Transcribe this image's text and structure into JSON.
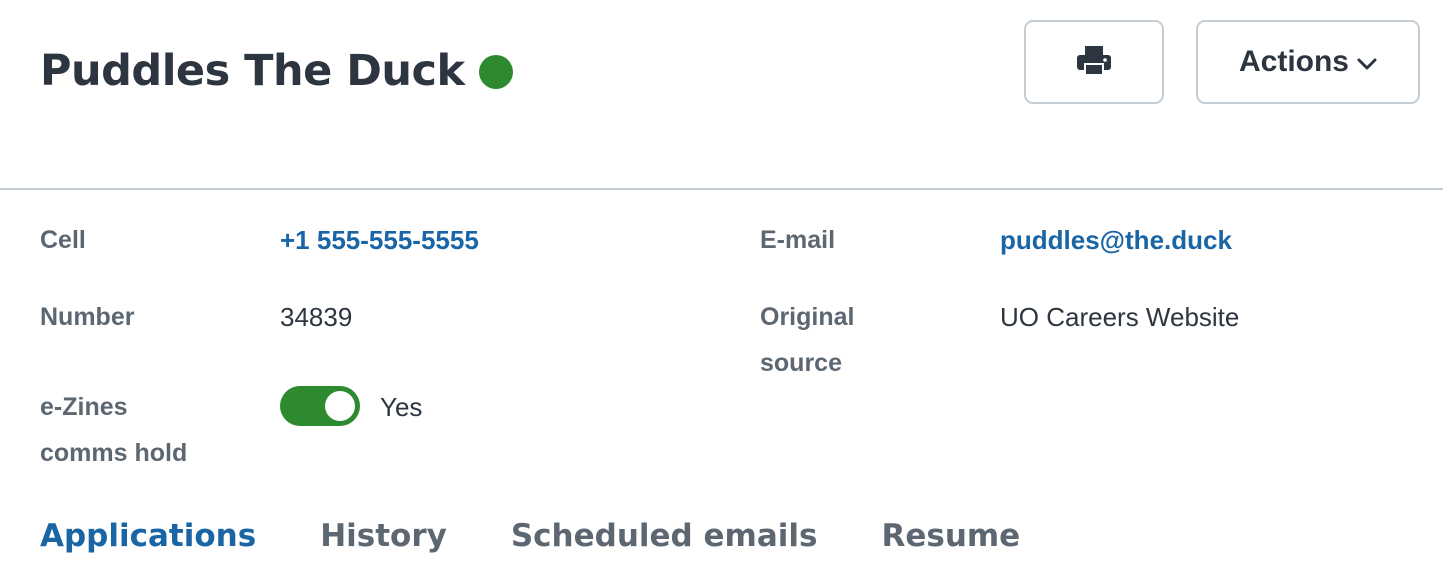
{
  "header": {
    "title": "Puddles The Duck",
    "status_color": "#2e8a2e",
    "print_icon": "printer-icon",
    "actions_label": "Actions",
    "actions_icon": "chevron-down-icon"
  },
  "details": {
    "cell": {
      "label": "Cell",
      "value": "+1 555-555-5555"
    },
    "email": {
      "label": "E-mail",
      "value": "puddles@the.duck"
    },
    "number": {
      "label": "Number",
      "value": "34839"
    },
    "source": {
      "label_line1": "Original",
      "label_line2": "source",
      "value": "UO Careers Website"
    },
    "ezines": {
      "label_line1": "e-Zines",
      "label_line2": "comms hold",
      "value": "Yes",
      "enabled": true,
      "toggle_color": "#2e8a2e"
    }
  },
  "tabs": [
    {
      "label": "Applications",
      "active": true
    },
    {
      "label": "History",
      "active": false
    },
    {
      "label": "Scheduled emails",
      "active": false
    },
    {
      "label": "Resume",
      "active": false
    }
  ],
  "colors": {
    "text": "#2d3640",
    "label": "#5d6772",
    "link": "#1a65a6",
    "border": "#c4ccd5"
  }
}
